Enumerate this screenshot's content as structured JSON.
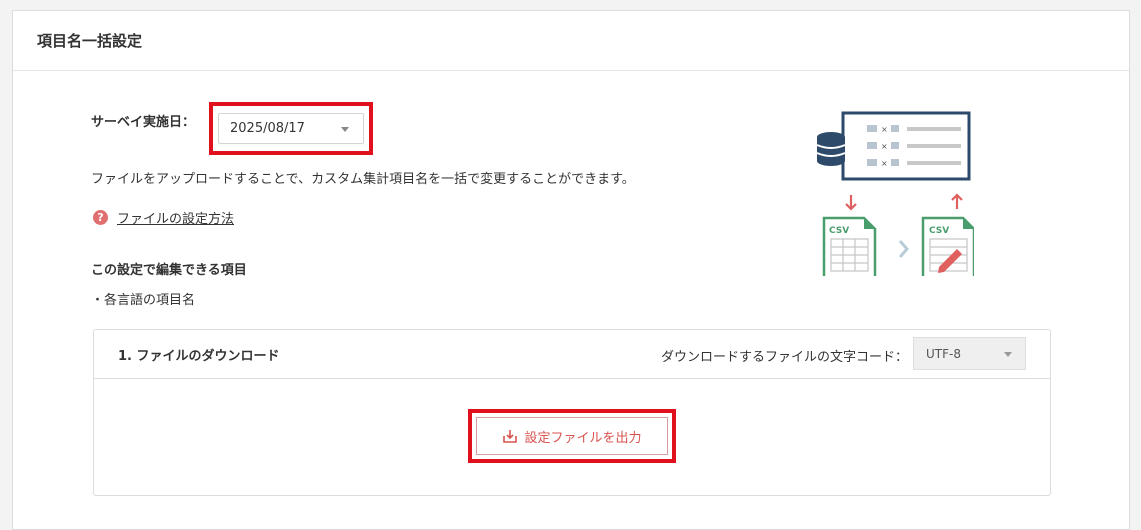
{
  "page": {
    "title": "項目名一括設定"
  },
  "survey": {
    "label": "サーベイ実施日：",
    "date_value": "2025/08/17"
  },
  "description": "ファイルをアップロードすることで、カスタム集計項目名を一括で変更することができます。",
  "help": {
    "icon": "question-circle-icon",
    "link_text": "ファイルの設定方法"
  },
  "editable": {
    "title": "この設定で編集できる項目",
    "items": [
      "・各言語の項目名"
    ]
  },
  "illustration": {
    "csv_left": "CSV",
    "csv_right": "CSV",
    "x_marks": [
      "×",
      "×",
      "×"
    ]
  },
  "download": {
    "section_title": "1. ファイルのダウンロード",
    "encoding_label": "ダウンロードするファイルの文字コード：",
    "encoding_value": "UTF-8",
    "output_button": "設定ファイルを出力"
  },
  "colors": {
    "highlight": "#e0101c",
    "accent_red": "#d9534f",
    "navy": "#2d4a6b",
    "csv_green": "#4a9e6e"
  }
}
